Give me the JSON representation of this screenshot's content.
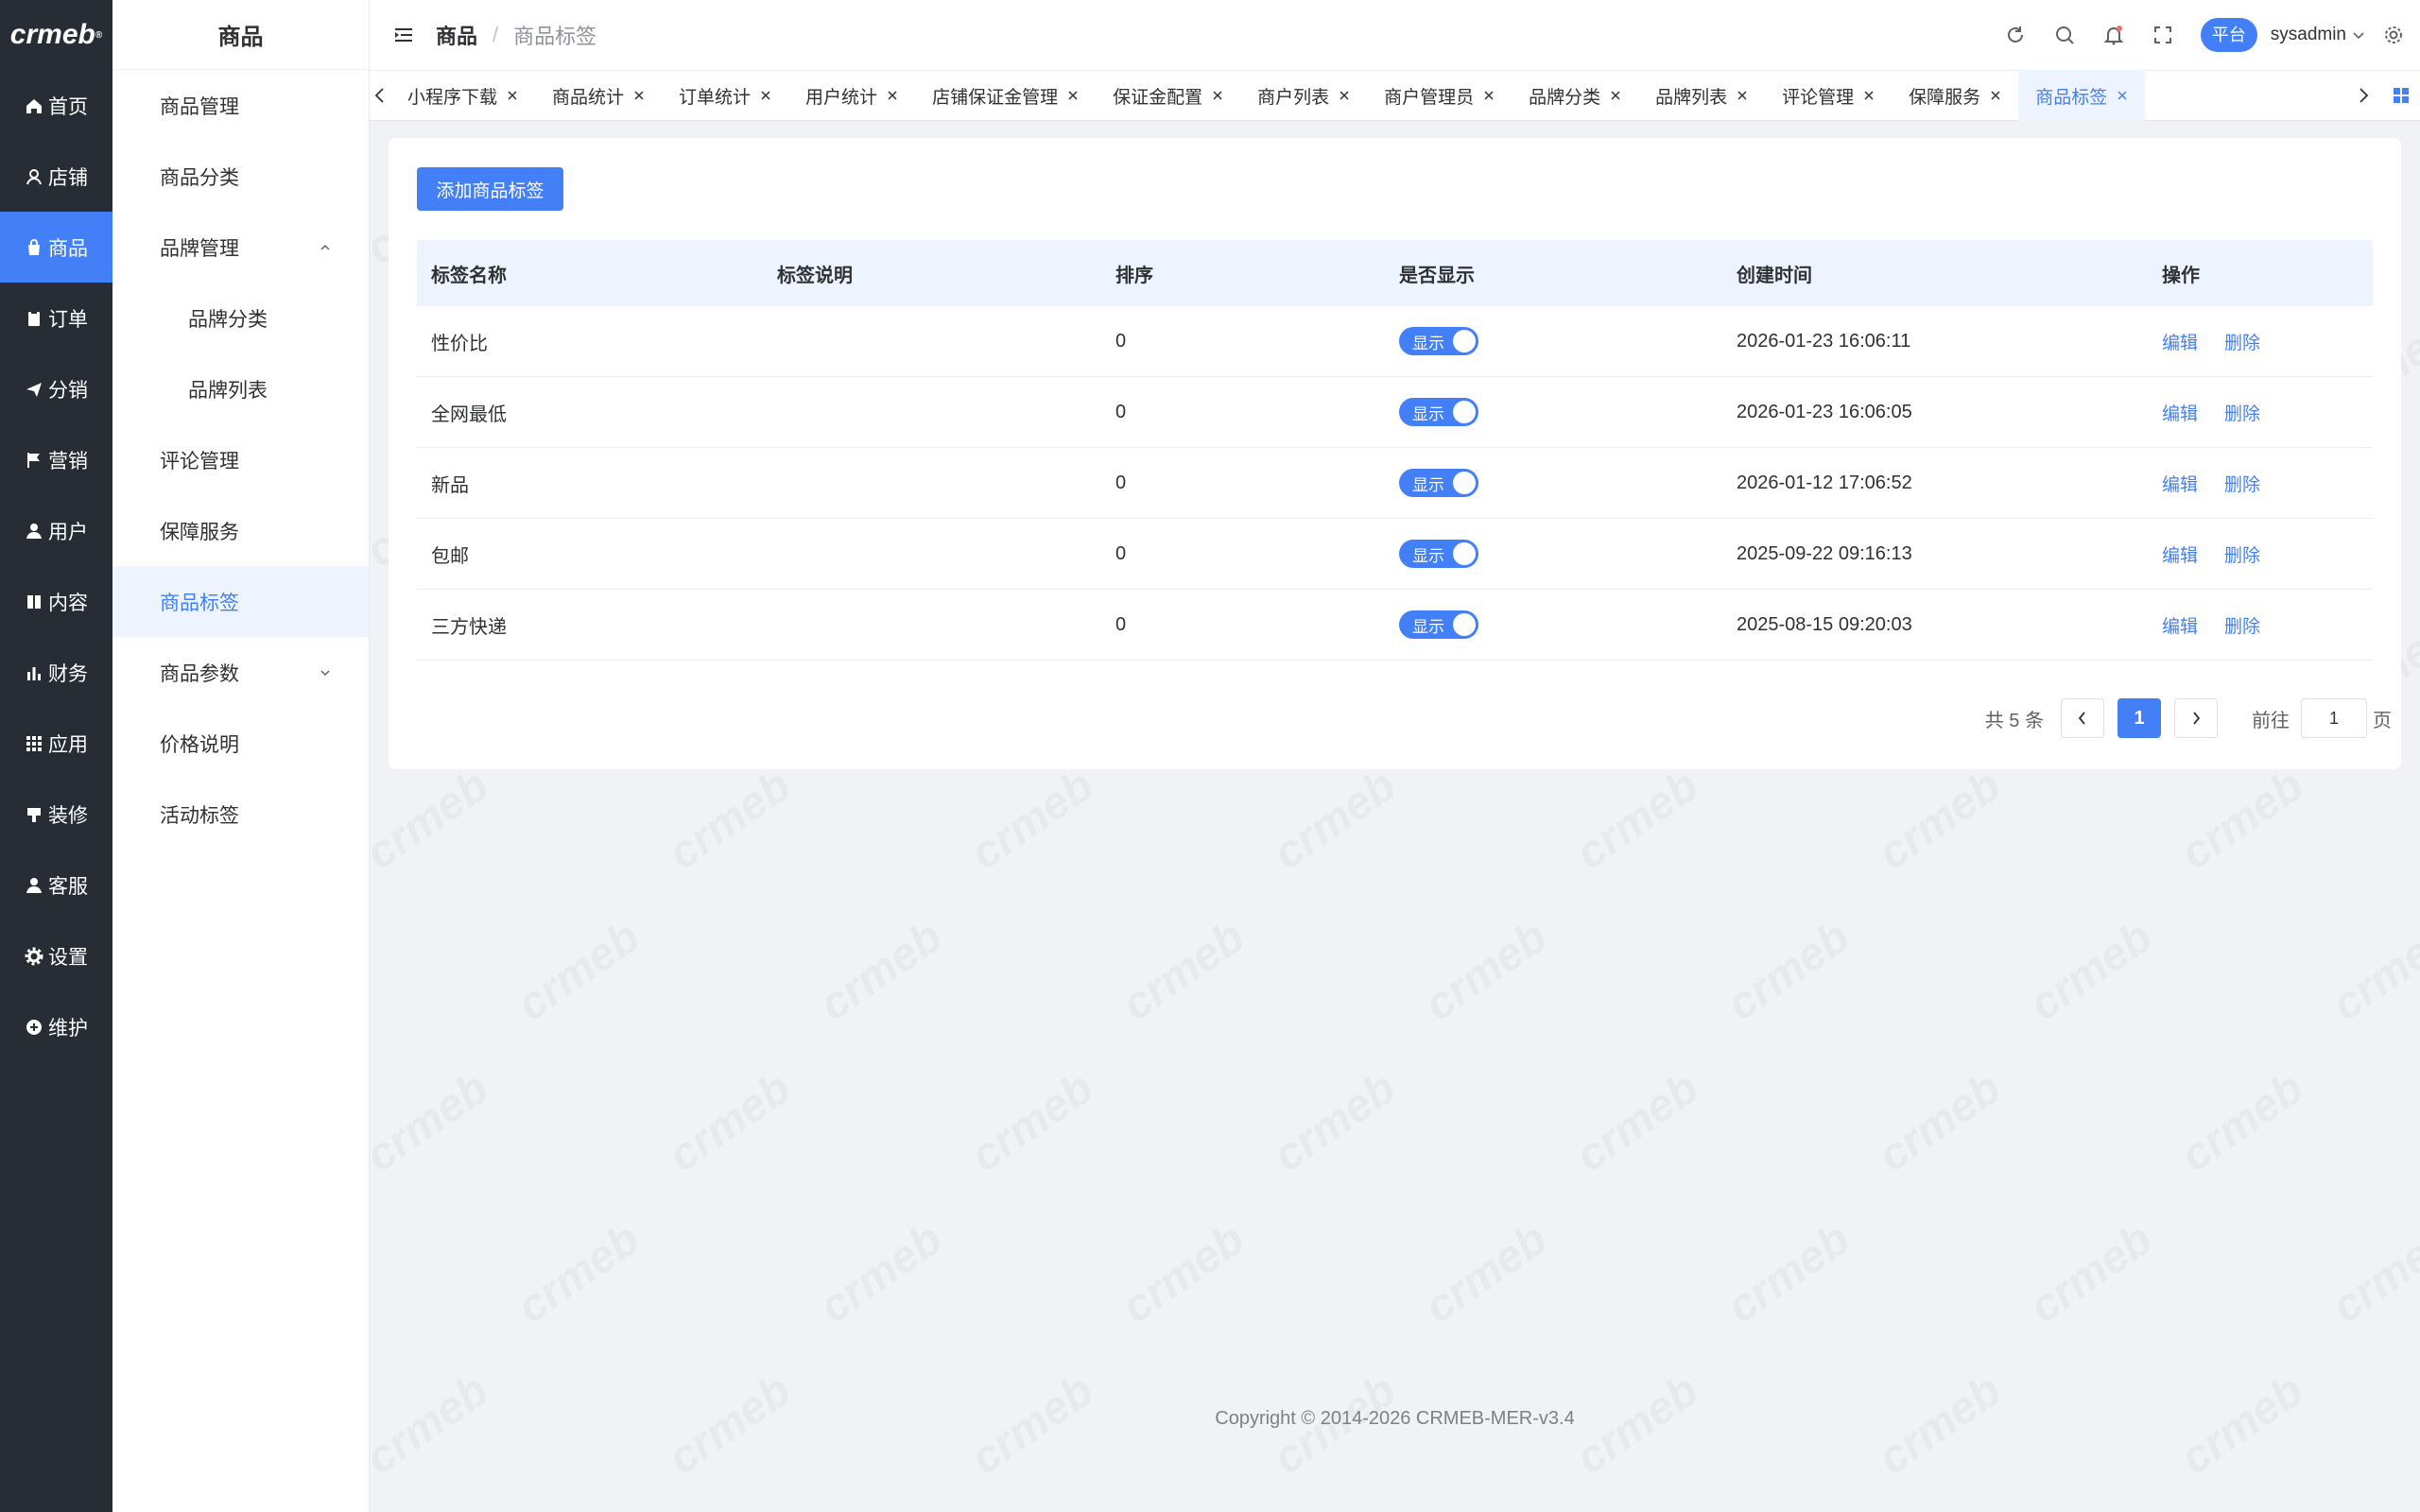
{
  "logo": {
    "text": "crmeb",
    "mark": "®"
  },
  "nav": {
    "items": [
      {
        "label": "首页",
        "icon": "home-icon"
      },
      {
        "label": "店铺",
        "icon": "store-icon"
      },
      {
        "label": "商品",
        "icon": "bag-icon",
        "active": true
      },
      {
        "label": "订单",
        "icon": "clipboard-icon"
      },
      {
        "label": "分销",
        "icon": "send-icon"
      },
      {
        "label": "营销",
        "icon": "flag-icon"
      },
      {
        "label": "用户",
        "icon": "user-icon"
      },
      {
        "label": "内容",
        "icon": "book-icon"
      },
      {
        "label": "财务",
        "icon": "bar-chart-icon"
      },
      {
        "label": "应用",
        "icon": "grid-icon"
      },
      {
        "label": "装修",
        "icon": "brush-icon"
      },
      {
        "label": "客服",
        "icon": "support-icon"
      },
      {
        "label": "设置",
        "icon": "gear-icon"
      },
      {
        "label": "维护",
        "icon": "maintenance-icon"
      }
    ]
  },
  "submenu": {
    "title": "商品",
    "items": [
      {
        "label": "商品管理"
      },
      {
        "label": "商品分类"
      },
      {
        "label": "品牌管理",
        "expanded": true
      },
      {
        "label": "品牌分类",
        "child": true
      },
      {
        "label": "品牌列表",
        "child": true
      },
      {
        "label": "评论管理"
      },
      {
        "label": "保障服务"
      },
      {
        "label": "商品标签",
        "active": true
      },
      {
        "label": "商品参数",
        "collapsed": true
      },
      {
        "label": "价格说明"
      },
      {
        "label": "活动标签"
      }
    ]
  },
  "header": {
    "breadcrumb_parent": "商品",
    "breadcrumb_sep": "/",
    "breadcrumb_current": "商品标签",
    "platform": "平台",
    "username": "sysadmin"
  },
  "tabs": [
    {
      "label": "小程序下载"
    },
    {
      "label": "商品统计"
    },
    {
      "label": "订单统计"
    },
    {
      "label": "用户统计"
    },
    {
      "label": "店铺保证金管理"
    },
    {
      "label": "保证金配置"
    },
    {
      "label": "商户列表"
    },
    {
      "label": "商户管理员"
    },
    {
      "label": "品牌分类"
    },
    {
      "label": "品牌列表"
    },
    {
      "label": "评论管理"
    },
    {
      "label": "保障服务"
    },
    {
      "label": "商品标签",
      "active": true
    }
  ],
  "content": {
    "add_button": "添加商品标签",
    "columns": [
      "标签名称",
      "标签说明",
      "排序",
      "是否显示",
      "创建时间",
      "操作"
    ],
    "rows": [
      {
        "name": "性价比",
        "desc": "",
        "sort": "0",
        "show": "显示",
        "time": "2026-01-23 16:06:11"
      },
      {
        "name": "全网最低",
        "desc": "",
        "sort": "0",
        "show": "显示",
        "time": "2026-01-23 16:06:05"
      },
      {
        "name": "新品",
        "desc": "",
        "sort": "0",
        "show": "显示",
        "time": "2026-01-12 17:06:52"
      },
      {
        "name": "包邮",
        "desc": "",
        "sort": "0",
        "show": "显示",
        "time": "2025-09-22 09:16:13"
      },
      {
        "name": "三方快递",
        "desc": "",
        "sort": "0",
        "show": "显示",
        "time": "2025-08-15 09:20:03"
      }
    ],
    "action_edit": "编辑",
    "action_delete": "删除"
  },
  "pager": {
    "total": "共 5 条",
    "current": "1",
    "goto_label": "前往",
    "goto_value": "1",
    "page_suffix": "页"
  },
  "footer": "Copyright © 2014-2026 CRMEB-MER-v3.4",
  "colors": {
    "accent": "#437ff6",
    "nav_bg": "#282c34"
  }
}
